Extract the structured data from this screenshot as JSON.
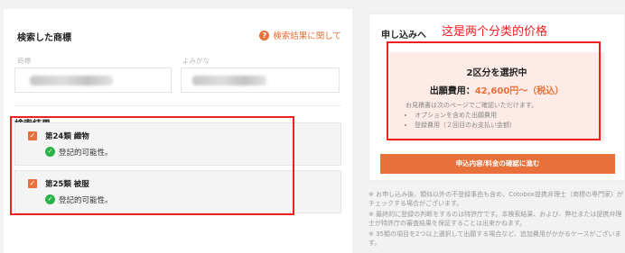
{
  "left": {
    "title": "検索した商標",
    "help_label": "検索結果に関して",
    "field_labels": [
      "商標",
      "よみがな"
    ],
    "result_title": "検索結果",
    "classes": [
      {
        "name": "第24類 織物",
        "status": "登記的可能性。"
      },
      {
        "name": "第25類 被服",
        "status": "登記的可能性。"
      }
    ]
  },
  "right": {
    "title": "申し込みへ",
    "annotation": "这是两个分类的价格",
    "price_box": {
      "title": "2区分を選択中",
      "price_label": "出願費用：",
      "price_value": "42,600円〜（税込）",
      "note": "お見積書は次のページでご確認いただけます。",
      "items": [
        "オプションを含めた出願費用",
        "登録費用（２回目のお支払い金額）"
      ]
    },
    "cta_label": "申込内容/料金の確認に進む"
  },
  "notes": [
    "※ お申し込み後、類似以外の不登録事由も含め、Cotobox提携弁理士（商標の専門家）がチェックする場合がございます。",
    "※ 最終的に登録の判断をするのは特許庁です。本検索結果、および、弊社または提携弁理士が特許庁の審査結果を保証することは出来かねます。",
    "※ 35類の項目を2つ以上選択して出願する場合など、追加費用がかかるケースがございます。"
  ],
  "colors": {
    "accent": "#e8703a",
    "success": "#2bb34a",
    "annotation": "#f02020"
  }
}
